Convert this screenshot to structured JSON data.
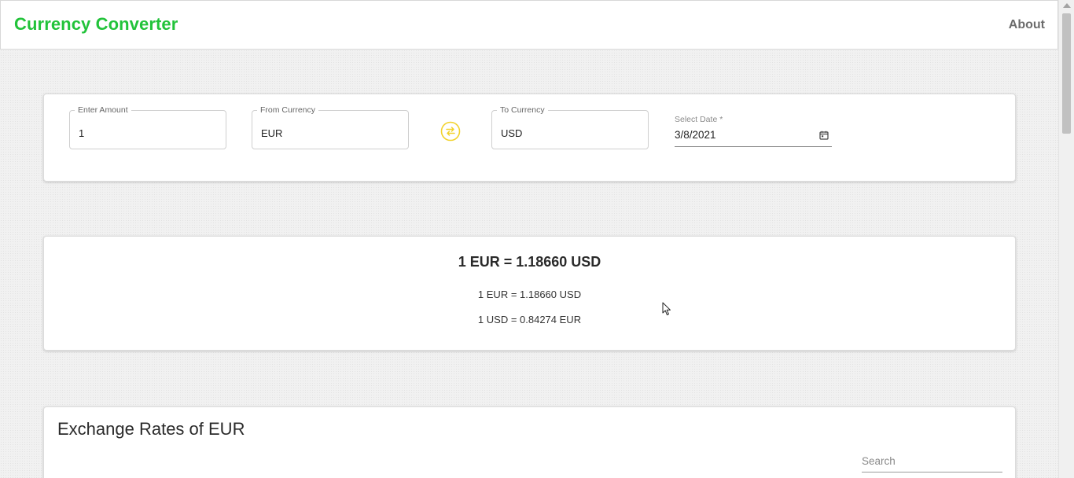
{
  "navbar": {
    "brand": "Currency Converter",
    "about_label": "About",
    "brand_color": "#22c33a"
  },
  "converter": {
    "amount": {
      "label": "Enter Amount",
      "value": "1"
    },
    "from_currency": {
      "label": "From Currency",
      "value": "EUR"
    },
    "swap_icon": "swap-arrows-icon",
    "to_currency": {
      "label": "To Currency",
      "value": "USD"
    },
    "date": {
      "label": "Select Date *",
      "value": "3/8/2021",
      "icon": "calendar-icon"
    },
    "accent_color": "#f2d22b"
  },
  "result": {
    "headline": "1 EUR = 1.18660 USD",
    "forward_rate": "1 EUR = 1.18660 USD",
    "inverse_rate": "1 USD = 0.84274 EUR"
  },
  "rates": {
    "title": "Exchange Rates of EUR",
    "search_placeholder": "Search"
  }
}
